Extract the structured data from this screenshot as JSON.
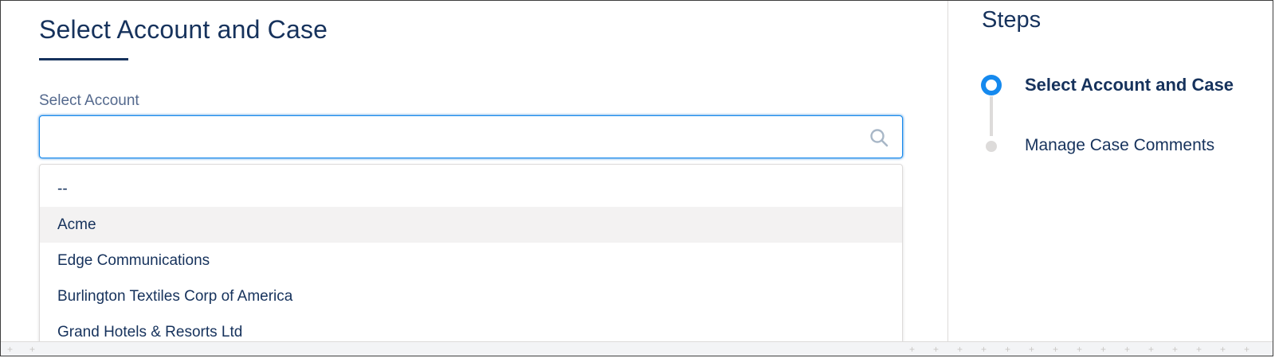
{
  "main": {
    "title": "Select Account and Case",
    "field_label": "Select Account",
    "search_value": "",
    "search_placeholder": ""
  },
  "dropdown": {
    "options": [
      "--",
      "Acme",
      "Edge Communications",
      "Burlington Textiles Corp of America",
      "Grand Hotels & Resorts Ltd"
    ],
    "highlighted_index": 1
  },
  "steps": {
    "title": "Steps",
    "items": [
      {
        "label": "Select Account and Case",
        "state": "current"
      },
      {
        "label": "Manage Case Comments",
        "state": "pending"
      }
    ]
  },
  "icons": {
    "search": "search-icon"
  },
  "colors": {
    "text": "#16325c",
    "accent": "#1589ee",
    "muted": "#54698d",
    "border": "#dddbda",
    "hover": "#f3f2f2"
  }
}
